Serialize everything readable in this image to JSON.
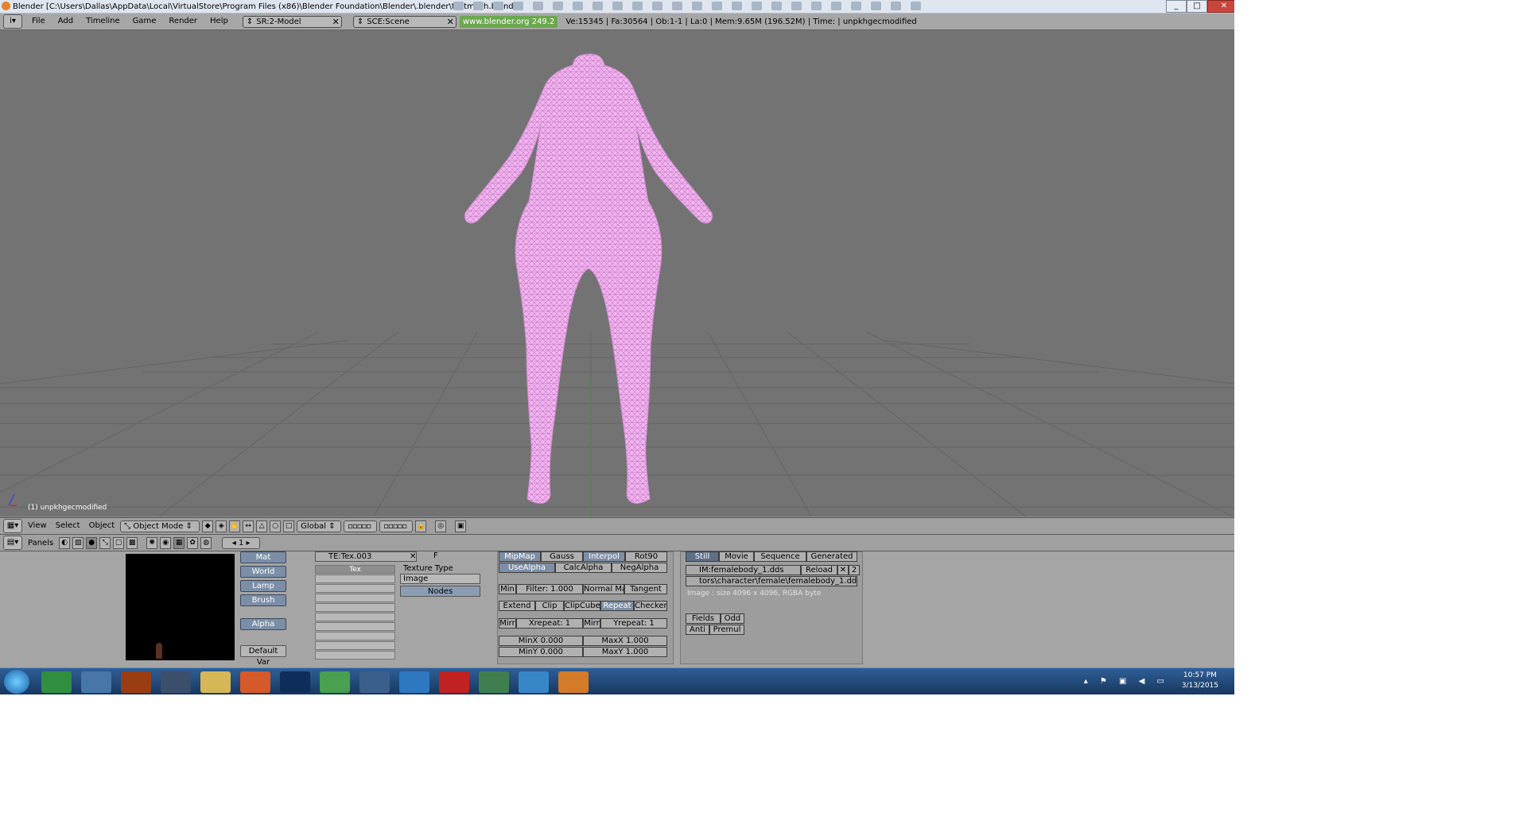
{
  "window": {
    "title": "Blender [C:\\Users\\Dallas\\AppData\\Local\\VirtualStore\\Program Files (x86)\\Blender Foundation\\Blender\\.blender\\testmesh.blend]",
    "minimize": "_",
    "maximize": "□",
    "close": "✕"
  },
  "header": {
    "menus": [
      "File",
      "Add",
      "Timeline",
      "Game",
      "Render",
      "Help"
    ],
    "screen": "SR:2-Model",
    "scene": "SCE:Scene",
    "site": "www.blender.org 249.2",
    "stats": "Ve:15345 | Fa:30564 | Ob:1-1 | La:0  | Mem:9.65M (196.52M) | Time: | unpkhgecmodified"
  },
  "viewport": {
    "object_label": "(1) unpkhgecmodified",
    "mesh_color": "#f4b4f2",
    "bg_color": "#737373"
  },
  "view_header": {
    "menus": [
      "View",
      "Select",
      "Object"
    ],
    "mode": "Object Mode",
    "orientation": "Global"
  },
  "buttons_header": {
    "panels_label": "Panels",
    "frame": "1"
  },
  "shading": {
    "tabs": [
      "Mat",
      "World",
      "Lamp",
      "Brush"
    ],
    "alpha": "Alpha",
    "default_var": "Default Var"
  },
  "texture": {
    "name": "TE:Tex.003",
    "f_label": "F",
    "slot_label": "Tex",
    "type_label": "Texture Type",
    "type_value": "Image",
    "nodes": "Nodes"
  },
  "image_opts": {
    "row1": [
      "MipMap",
      "Gauss",
      "Interpol",
      "Rot90"
    ],
    "row2": [
      "UseAlpha",
      "CalcAlpha",
      "NegAlpha"
    ],
    "min_label": "Min",
    "filter": "Filter: 1.000",
    "normal_map": "Normal Ma",
    "tangent": "Tangent",
    "row4": [
      "Extend",
      "Clip",
      "ClipCube",
      "Repeat",
      "Checker"
    ],
    "mirr1": "Mirr",
    "xrepeat": "Xrepeat: 1",
    "mirr2": "Mirr",
    "yrepeat": "Yrepeat: 1",
    "minx": "MinX 0.000",
    "maxx": "MaxX 1.000",
    "miny": "MinY 0.000",
    "maxy": "MaxY 1.000"
  },
  "image": {
    "tabs": [
      "Still",
      "Movie",
      "Sequence",
      "Generated"
    ],
    "name": "IM:femalebody_1.dds",
    "reload": "Reload",
    "users": "2",
    "path": "tors\\character\\female\\femalebody_1.dds",
    "info": "Image : size 4096 x 4096, RGBA byte",
    "fields": "Fields",
    "odd": "Odd",
    "anti": "Anti",
    "premul": "Premul"
  },
  "taskbar": {
    "time": "10:57 PM",
    "date": "3/13/2015"
  }
}
